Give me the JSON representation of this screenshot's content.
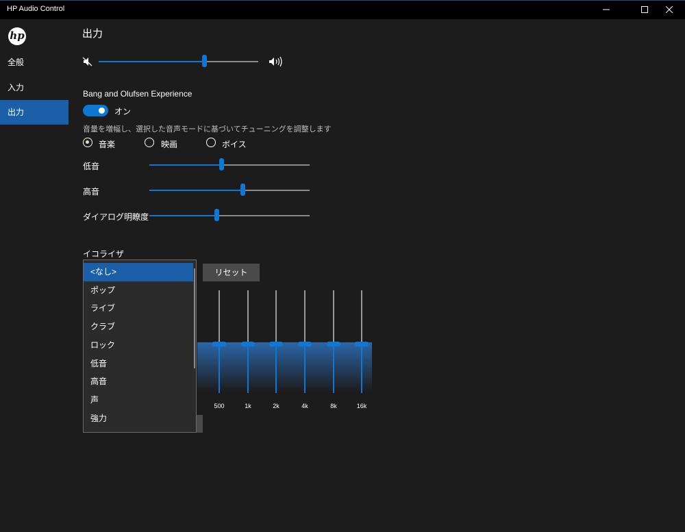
{
  "window": {
    "title": "HP Audio Control"
  },
  "sidebar": {
    "logo": "hp",
    "items": [
      {
        "label": "全般",
        "active": false
      },
      {
        "label": "入力",
        "active": false
      },
      {
        "label": "出力",
        "active": true
      }
    ]
  },
  "main": {
    "title": "出力",
    "volume": {
      "level": 0.66,
      "mute_icon": "speaker-muted-icon",
      "max_icon": "speaker-loud-icon"
    },
    "bo": {
      "label": "Bang and Olufsen Experience",
      "toggle_state": "オン",
      "description": "音量を増幅し、選択した音声モードに基づいてチューニングを調整します",
      "modes": [
        {
          "label": "音楽",
          "checked": true
        },
        {
          "label": "映画",
          "checked": false
        },
        {
          "label": "ボイス",
          "checked": false
        }
      ],
      "sliders": [
        {
          "label": "低音",
          "level": 0.45
        },
        {
          "label": "高音",
          "level": 0.58
        },
        {
          "label": "ダイアログ明瞭度",
          "level": 0.42
        }
      ]
    },
    "equalizer": {
      "label": "イコライザ",
      "reset_label": "リセット",
      "bands": [
        "500",
        "1k",
        "2k",
        "4k",
        "8k",
        "16k"
      ],
      "dropdown_options": [
        "<なし>",
        "ポップ",
        "ライブ",
        "クラブ",
        "ロック",
        "低音",
        "高音",
        "声",
        "強力"
      ],
      "selected": "<なし>"
    }
  },
  "colors": {
    "accent": "#0f78d4",
    "selection": "#1b5fa8",
    "background": "#1c1c1c"
  }
}
